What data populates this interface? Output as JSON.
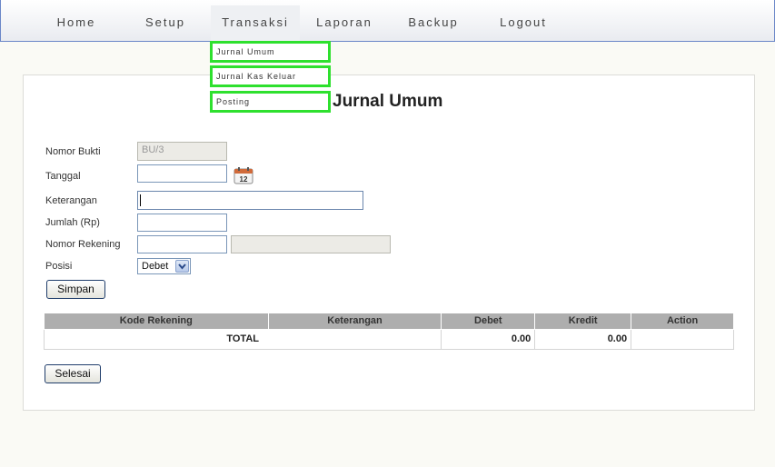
{
  "nav": {
    "items": [
      {
        "label": "Home"
      },
      {
        "label": "Setup"
      },
      {
        "label": "Transaksi"
      },
      {
        "label": "Laporan"
      },
      {
        "label": "Backup"
      },
      {
        "label": "Logout"
      }
    ],
    "active_index": 2
  },
  "dropdown": {
    "items": [
      {
        "label": "Jurnal Umum"
      },
      {
        "label": "Jurnal Kas Keluar"
      },
      {
        "label": "Posting"
      }
    ],
    "highlight_color": "#2ee02e"
  },
  "page": {
    "title": "Jurnal Umum"
  },
  "form": {
    "nomor_bukti": {
      "label": "Nomor Bukti",
      "value": "BU/3"
    },
    "tanggal": {
      "label": "Tanggal",
      "value": ""
    },
    "calendar_icon_text": "12",
    "keterangan": {
      "label": "Keterangan",
      "value": ""
    },
    "jumlah": {
      "label": "Jumlah (Rp)",
      "value": ""
    },
    "nomor_rekening": {
      "label": "Nomor Rekening",
      "value": "",
      "name_value": ""
    },
    "posisi": {
      "label": "Posisi",
      "selected": "Debet"
    },
    "simpan_label": "Simpan"
  },
  "table": {
    "headers": [
      "Kode Rekening",
      "Keterangan",
      "Debet",
      "Kredit",
      "Action"
    ],
    "total_row": {
      "label": "TOTAL",
      "debet": "0.00",
      "kredit": "0.00",
      "action": ""
    }
  },
  "selesai_label": "Selesai"
}
